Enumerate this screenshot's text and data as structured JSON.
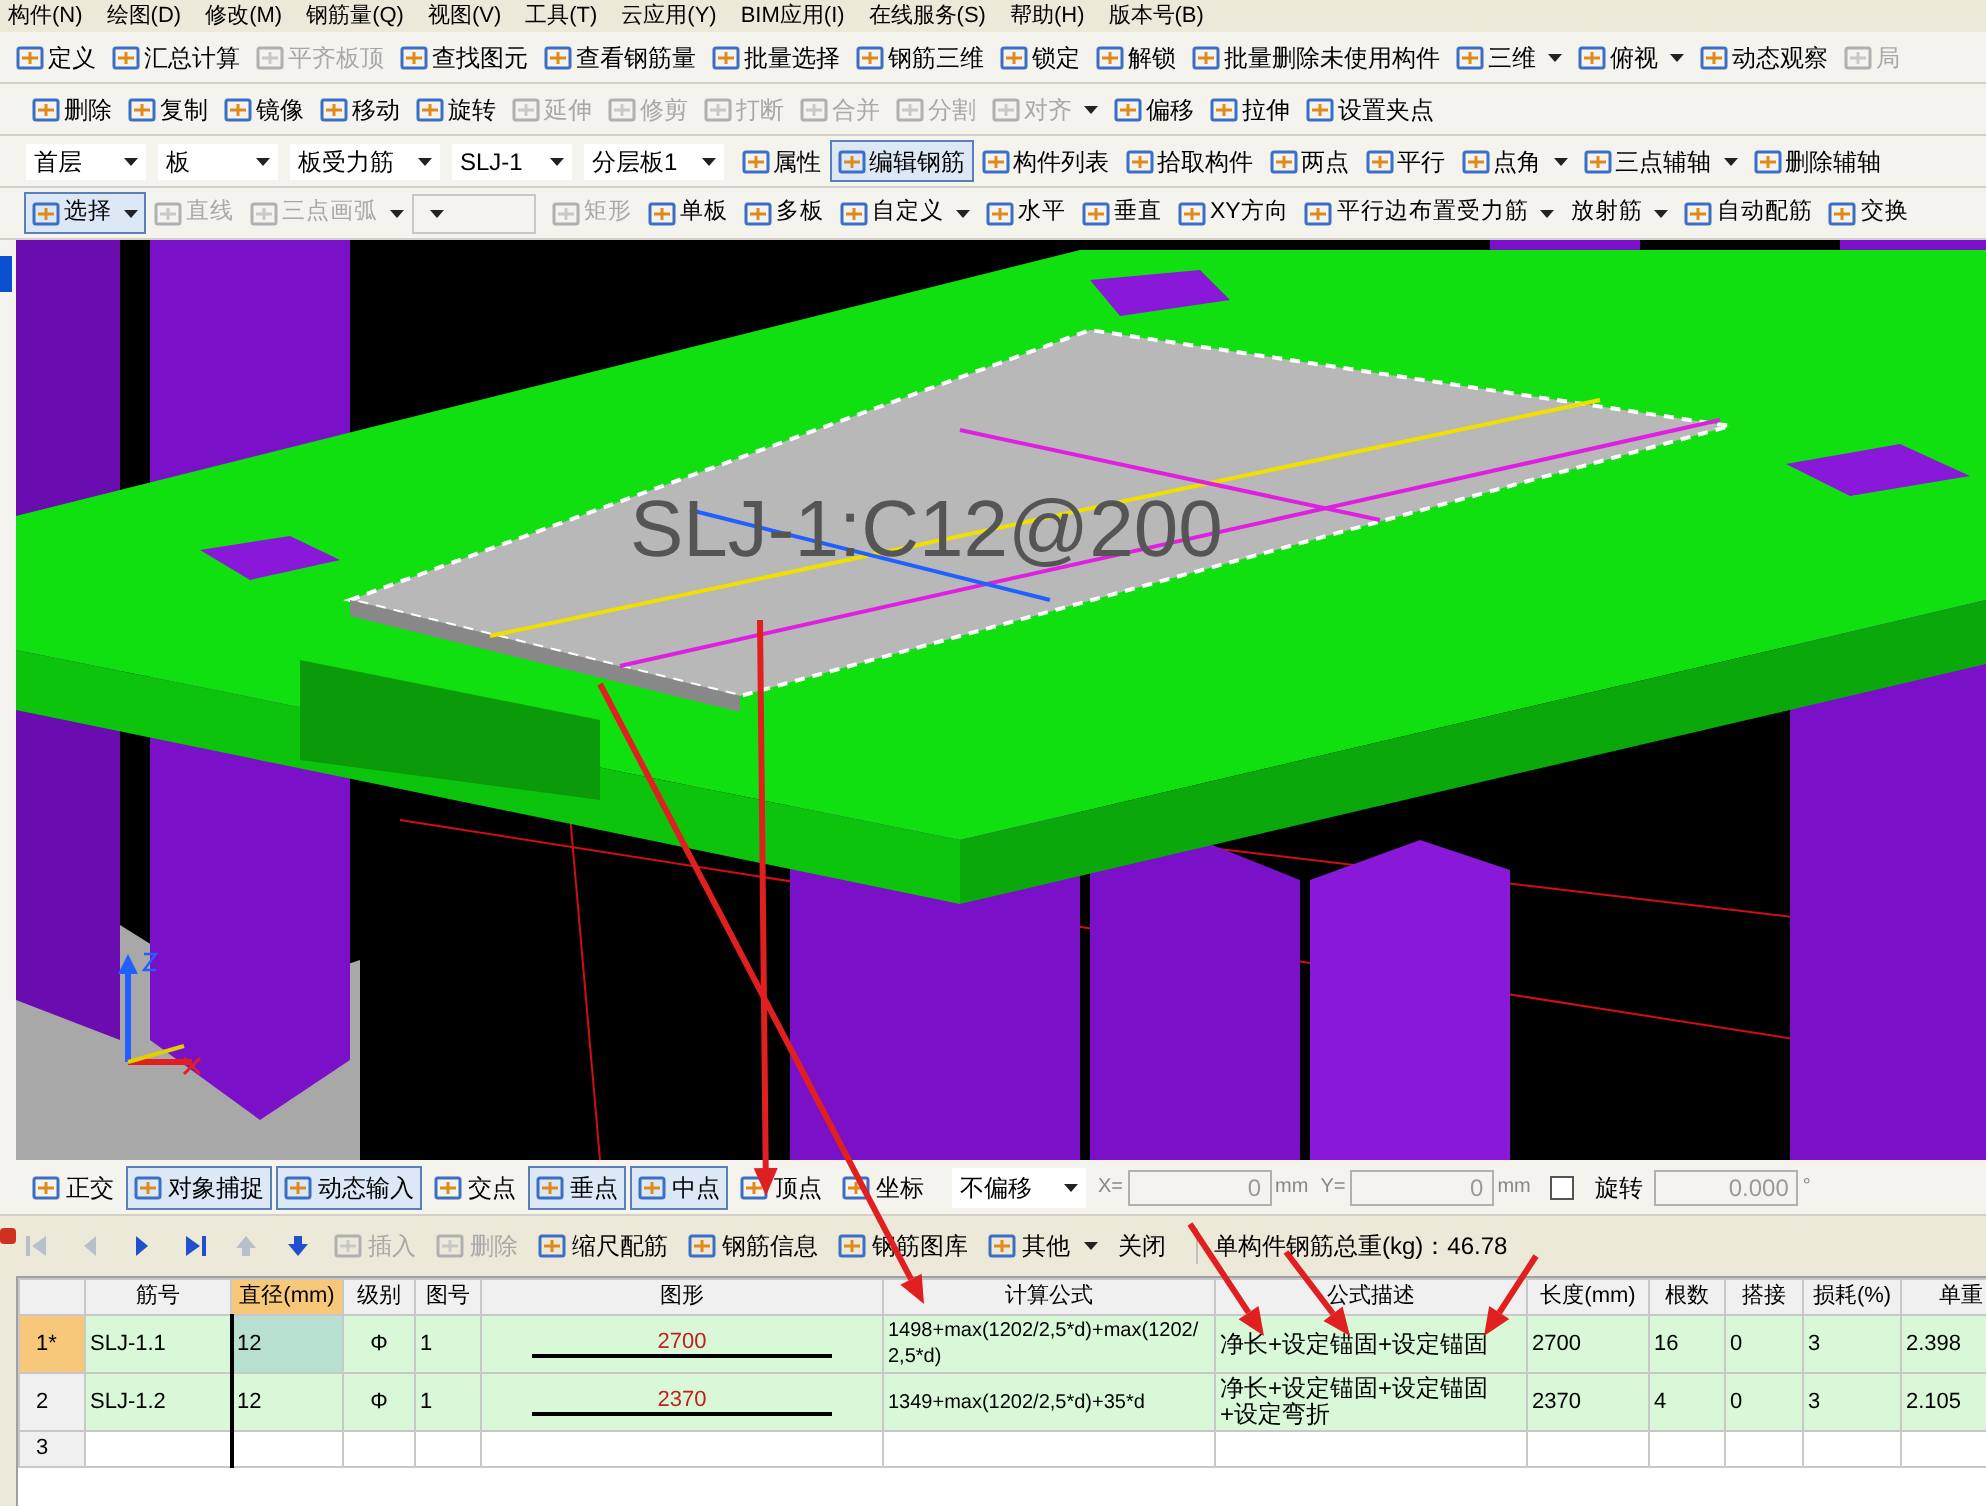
{
  "menu": [
    "构件(N)",
    "绘图(D)",
    "修改(M)",
    "钢筋量(Q)",
    "视图(V)",
    "工具(T)",
    "云应用(Y)",
    "BIM应用(I)",
    "在线服务(S)",
    "帮助(H)",
    "版本号(B)"
  ],
  "toolbars": [
    [
      {
        "kind": "button",
        "label": "定义",
        "disabled": false,
        "selected": false,
        "dropdown": false
      },
      {
        "kind": "button",
        "label": "汇总计算",
        "disabled": false,
        "selected": false,
        "dropdown": false
      },
      {
        "kind": "button",
        "label": "平齐板顶",
        "disabled": true,
        "selected": false,
        "dropdown": false
      },
      {
        "kind": "button",
        "label": "查找图元",
        "disabled": false,
        "selected": false,
        "dropdown": false
      },
      {
        "kind": "button",
        "label": "查看钢筋量",
        "disabled": false,
        "selected": false,
        "dropdown": false
      },
      {
        "kind": "button",
        "label": "批量选择",
        "disabled": false,
        "selected": false,
        "dropdown": false
      },
      {
        "kind": "button",
        "label": "钢筋三维",
        "disabled": false,
        "selected": false,
        "dropdown": false
      },
      {
        "kind": "button",
        "label": "锁定",
        "disabled": false,
        "selected": false,
        "dropdown": false
      },
      {
        "kind": "button",
        "label": "解锁",
        "disabled": false,
        "selected": false,
        "dropdown": false
      },
      {
        "kind": "button",
        "label": "批量删除未使用构件",
        "disabled": false,
        "selected": false,
        "dropdown": false
      },
      {
        "kind": "button",
        "label": "三维",
        "disabled": false,
        "selected": false,
        "dropdown": true
      },
      {
        "kind": "button",
        "label": "俯视",
        "disabled": false,
        "selected": false,
        "dropdown": true
      },
      {
        "kind": "button",
        "label": "动态观察",
        "disabled": false,
        "selected": false,
        "dropdown": false
      },
      {
        "kind": "button",
        "label": "局",
        "disabled": true,
        "selected": false,
        "dropdown": false
      }
    ],
    [
      {
        "kind": "button",
        "label": "删除",
        "disabled": false,
        "selected": false,
        "dropdown": false
      },
      {
        "kind": "button",
        "label": "复制",
        "disabled": false,
        "selected": false,
        "dropdown": false
      },
      {
        "kind": "button",
        "label": "镜像",
        "disabled": false,
        "selected": false,
        "dropdown": false
      },
      {
        "kind": "button",
        "label": "移动",
        "disabled": false,
        "selected": false,
        "dropdown": false
      },
      {
        "kind": "button",
        "label": "旋转",
        "disabled": false,
        "selected": false,
        "dropdown": false
      },
      {
        "kind": "button",
        "label": "延伸",
        "disabled": true,
        "selected": false,
        "dropdown": false
      },
      {
        "kind": "button",
        "label": "修剪",
        "disabled": true,
        "selected": false,
        "dropdown": false
      },
      {
        "kind": "button",
        "label": "打断",
        "disabled": true,
        "selected": false,
        "dropdown": false
      },
      {
        "kind": "button",
        "label": "合并",
        "disabled": true,
        "selected": false,
        "dropdown": false
      },
      {
        "kind": "button",
        "label": "分割",
        "disabled": true,
        "selected": false,
        "dropdown": false
      },
      {
        "kind": "button",
        "label": "对齐",
        "disabled": true,
        "selected": false,
        "dropdown": true
      },
      {
        "kind": "button",
        "label": "偏移",
        "disabled": false,
        "selected": false,
        "dropdown": false
      },
      {
        "kind": "button",
        "label": "拉伸",
        "disabled": false,
        "selected": false,
        "dropdown": false
      },
      {
        "kind": "button",
        "label": "设置夹点",
        "disabled": false,
        "selected": false,
        "dropdown": false
      }
    ],
    [
      {
        "kind": "select",
        "label": "首层",
        "disabled": false,
        "selected": false,
        "dropdown": true
      },
      {
        "kind": "select",
        "label": "板",
        "disabled": false,
        "selected": false,
        "dropdown": true
      },
      {
        "kind": "select",
        "label": "板受力筋",
        "disabled": false,
        "selected": false,
        "dropdown": true
      },
      {
        "kind": "select",
        "label": "SLJ-1",
        "disabled": false,
        "selected": false,
        "dropdown": true
      },
      {
        "kind": "select",
        "label": "分层板1",
        "disabled": false,
        "selected": false,
        "dropdown": true
      },
      {
        "kind": "button",
        "label": "属性",
        "disabled": false,
        "selected": false,
        "dropdown": false
      },
      {
        "kind": "button",
        "label": "编辑钢筋",
        "disabled": false,
        "selected": true,
        "dropdown": false
      },
      {
        "kind": "button",
        "label": "构件列表",
        "disabled": false,
        "selected": false,
        "dropdown": false
      },
      {
        "kind": "button",
        "label": "拾取构件",
        "disabled": false,
        "selected": false,
        "dropdown": false
      },
      {
        "kind": "button",
        "label": "两点",
        "disabled": false,
        "selected": false,
        "dropdown": false
      },
      {
        "kind": "button",
        "label": "平行",
        "disabled": false,
        "selected": false,
        "dropdown": false
      },
      {
        "kind": "button",
        "label": "点角",
        "disabled": false,
        "selected": false,
        "dropdown": true
      },
      {
        "kind": "button",
        "label": "三点辅轴",
        "disabled": false,
        "selected": false,
        "dropdown": true
      },
      {
        "kind": "button",
        "label": "删除辅轴",
        "disabled": false,
        "selected": false,
        "dropdown": false
      }
    ],
    [
      {
        "kind": "button",
        "label": "选择",
        "disabled": false,
        "selected": true,
        "dropdown": true
      },
      {
        "kind": "button",
        "label": "直线",
        "disabled": true,
        "selected": false,
        "dropdown": false
      },
      {
        "kind": "button",
        "label": "三点画弧",
        "disabled": true,
        "selected": false,
        "dropdown": true
      },
      {
        "kind": "select",
        "disabled": true,
        "selected": false,
        "dropdown": true
      },
      {
        "kind": "button",
        "label": "矩形",
        "disabled": true,
        "selected": false,
        "dropdown": false
      },
      {
        "kind": "button",
        "label": "单板",
        "disabled": false,
        "selected": false,
        "dropdown": false
      },
      {
        "kind": "button",
        "label": "多板",
        "disabled": false,
        "selected": false,
        "dropdown": false
      },
      {
        "kind": "button",
        "label": "自定义",
        "disabled": false,
        "selected": false,
        "dropdown": true
      },
      {
        "kind": "button",
        "label": "水平",
        "disabled": false,
        "selected": false,
        "dropdown": false
      },
      {
        "kind": "button",
        "label": "垂直",
        "disabled": false,
        "selected": false,
        "dropdown": false
      },
      {
        "kind": "button",
        "label": "XY方向",
        "disabled": false,
        "selected": false,
        "dropdown": false
      },
      {
        "kind": "button",
        "label": "平行边布置受力筋",
        "disabled": false,
        "selected": false,
        "dropdown": true
      },
      {
        "kind": "text",
        "label": "放射筋",
        "disabled": false,
        "selected": false,
        "dropdown": true
      },
      {
        "kind": "button",
        "label": "自动配筋",
        "disabled": false,
        "selected": false,
        "dropdown": false
      },
      {
        "kind": "button",
        "label": "交换",
        "disabled": false,
        "selected": false,
        "dropdown": false
      }
    ]
  ],
  "view": {
    "label": "SLJ-1:C12@200"
  },
  "snap_toolbar": [
    {
      "kind": "button",
      "label": "正交",
      "selected": false
    },
    {
      "kind": "button",
      "label": "对象捕捉",
      "selected": true
    },
    {
      "kind": "button",
      "label": "动态输入",
      "selected": true
    },
    {
      "kind": "button",
      "label": "交点",
      "selected": false
    },
    {
      "kind": "button",
      "label": "垂点",
      "selected": true
    },
    {
      "kind": "button",
      "label": "中点",
      "selected": true
    },
    {
      "kind": "button",
      "label": "顶点",
      "selected": false
    },
    {
      "kind": "button",
      "label": "坐标",
      "selected": false
    },
    {
      "kind": "select",
      "label": "不偏移"
    },
    {
      "kind": "field",
      "label": "X=",
      "value": "0",
      "unit": "mm"
    },
    {
      "kind": "field",
      "label": "Y=",
      "value": "0",
      "unit": "mm"
    },
    {
      "kind": "checkbox",
      "label": "旋转",
      "checked": false
    },
    {
      "kind": "field",
      "value": "0.000",
      "unit": "°"
    }
  ],
  "rebar_toolbar": [
    {
      "kind": "nav-first",
      "disabled": true
    },
    {
      "kind": "nav-prev",
      "disabled": true
    },
    {
      "kind": "nav-next",
      "disabled": false
    },
    {
      "kind": "nav-last",
      "disabled": false
    },
    {
      "kind": "nav-up",
      "disabled": true
    },
    {
      "kind": "nav-down",
      "disabled": false
    },
    {
      "kind": "button",
      "label": "插入",
      "disabled": true,
      "dropdown": false
    },
    {
      "kind": "button",
      "label": "删除",
      "disabled": true,
      "dropdown": false
    },
    {
      "kind": "button",
      "label": "缩尺配筋",
      "disabled": false,
      "dropdown": false
    },
    {
      "kind": "button",
      "label": "钢筋信息",
      "disabled": false,
      "dropdown": false
    },
    {
      "kind": "button",
      "label": "钢筋图库",
      "disabled": false,
      "dropdown": false
    },
    {
      "kind": "button",
      "label": "其他",
      "disabled": false,
      "dropdown": true
    },
    {
      "kind": "text",
      "label": "关闭",
      "disabled": false,
      "dropdown": false
    },
    {
      "kind": "info",
      "label": "单构件钢筋总重(kg)：46.78"
    }
  ],
  "table": {
    "columns": [
      {
        "label": "筋号",
        "kind": "text",
        "selected": false
      },
      {
        "label": "直径(mm)",
        "kind": "text",
        "selected": true
      },
      {
        "label": "级别",
        "kind": "center",
        "selected": false
      },
      {
        "label": "图号",
        "kind": "text",
        "selected": false
      },
      {
        "label": "图形",
        "kind": "shape",
        "selected": false
      },
      {
        "label": "计算公式",
        "kind": "formula",
        "selected": false
      },
      {
        "label": "公式描述",
        "kind": "text",
        "selected": false
      },
      {
        "label": "长度(mm)",
        "kind": "text",
        "selected": false
      },
      {
        "label": "根数",
        "kind": "text",
        "selected": false
      },
      {
        "label": "搭接",
        "kind": "text",
        "selected": false
      },
      {
        "label": "损耗(%)",
        "kind": "text",
        "selected": false
      },
      {
        "label": "单重",
        "kind": "text",
        "selected": false
      }
    ],
    "rows": [
      {
        "number": "1*",
        "selected": true,
        "cells": [
          "SLJ-1.1",
          "12",
          "Φ",
          "1",
          "2700",
          "1498+max(1202/2,5*d)+max(1202/2,5*d)",
          "净长+设定锚固+设定锚固",
          "2700",
          "16",
          "0",
          "3",
          "2.398"
        ]
      },
      {
        "number": "2",
        "selected": false,
        "cells": [
          "SLJ-1.2",
          "12",
          "Φ",
          "1",
          "2370",
          "1349+max(1202/2,5*d)+35*d",
          "净长+设定锚固+设定锚固+设定弯折",
          "2370",
          "4",
          "0",
          "3",
          "2.105"
        ]
      },
      {
        "number": "3",
        "selected": false,
        "cells": []
      }
    ]
  }
}
